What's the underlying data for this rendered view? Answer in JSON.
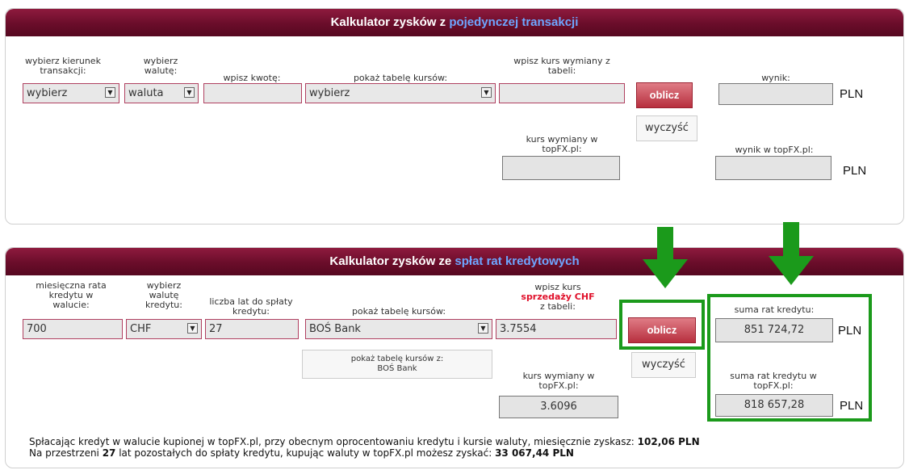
{
  "panel1": {
    "title_prefix": "Kalkulator zysków z ",
    "title_highlight": "pojedynczej transakcji",
    "labels": {
      "direction": "wybierz kierunek transakcji:",
      "currency": "wybierz walutę:",
      "amount": "wpisz kwotę:",
      "rate_table": "pokaż tabelę kursów:",
      "exchange_rate": "wpisz kurs wymiany z tabeli:",
      "result": "wynik:",
      "topfx_rate": "kurs wymiany w topFX.pl:",
      "topfx_result": "wynik w topFX.pl:"
    },
    "direction_value": "wybierz",
    "currency_value": "waluta",
    "amount_value": "",
    "rate_table_value": "wybierz",
    "exchange_rate_value": "",
    "result_value": "",
    "topfx_rate_value": "",
    "topfx_result_value": "",
    "calculate_label": "oblicz",
    "clear_label": "wyczyść",
    "pln1": "PLN",
    "pln2": "PLN"
  },
  "panel2": {
    "title_prefix": "Kalkulator zysków ze ",
    "title_highlight": "spłat rat kredytowych",
    "labels": {
      "monthly_rate": "miesięczna rata kredytu w walucie:",
      "loan_currency": "wybierz walutę kredytu:",
      "years": "liczba lat do spłaty kredytu:",
      "rate_table": "pokaż tabelę kursów:",
      "exchange_rate_line1": "wpisz kurs",
      "exchange_rate_highlight": "sprzedaży CHF",
      "exchange_rate_line3": "z tabeli:",
      "sum_rates": "suma rat kredytu:",
      "topfx_rate": "kurs wymiany w topFX.pl:",
      "sum_topfx": "suma rat kredytu w topFX.pl:"
    },
    "monthly_rate_value": "700",
    "loan_currency_value": "CHF",
    "years_value": "27",
    "rate_table_value": "BOŚ Bank",
    "exchange_rate_value": "3.7554",
    "sum_rates_value": "851 724,72",
    "topfx_rate_value": "3.6096",
    "sum_topfx_value": "818 657,28",
    "show_table_button_line1": "pokaż tabelę kursów z:",
    "show_table_button_line2": "BOŚ Bank",
    "calculate_label": "oblicz",
    "clear_label": "wyczyść",
    "pln1": "PLN",
    "pln2": "PLN"
  },
  "summary": {
    "line1_prefix": "Spłacając kredyt w walucie kupionej w topFX.pl, przy obecnym oprocentowaniu kredytu i kursie waluty, miesięcznie zyskasz: ",
    "line1_value": "102,06 PLN",
    "line2_prefix": "Na przestrzeni ",
    "line2_years": "27",
    "line2_middle": " lat pozostałych do spłaty kredytu, kupując waluty w topFX.pl możesz zyskać: ",
    "line2_value": "33 067,44 PLN"
  },
  "colors": {
    "header": "#6a0d2a",
    "title_highlight": "#6ea6ff",
    "annotation_green": "#1b9a1b",
    "sell_highlight": "#e0102a"
  }
}
